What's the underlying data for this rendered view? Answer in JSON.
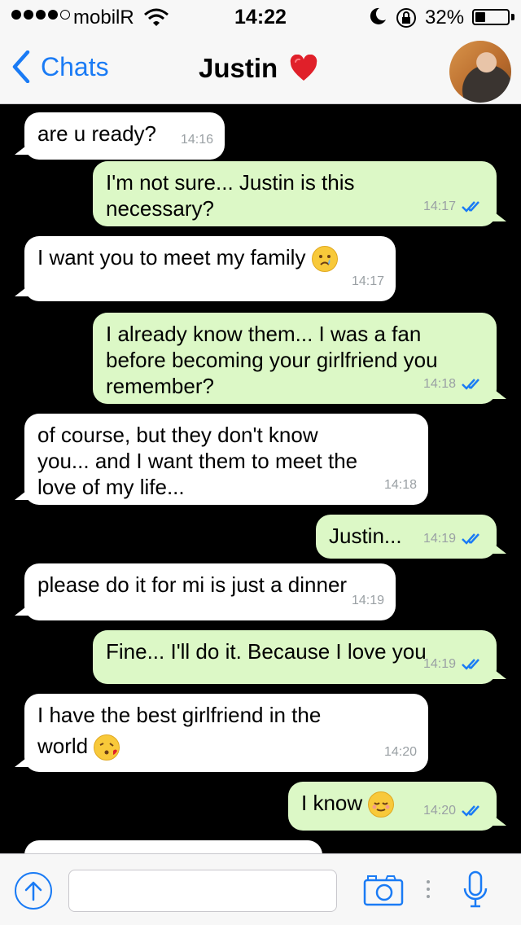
{
  "status_bar": {
    "carrier": "mobilR",
    "time": "14:22",
    "battery_percent": "32%",
    "battery_level": 0.32
  },
  "nav": {
    "back_label": "Chats",
    "contact_name": "Justin",
    "accent_color": "#1a7bf5"
  },
  "messages": [
    {
      "dir": "in",
      "text": "are u ready?",
      "time": "14:16"
    },
    {
      "dir": "out",
      "text_lines": [
        "I'm not sure... Justin is this",
        "necessary?"
      ],
      "time": "14:17",
      "read": true
    },
    {
      "dir": "in",
      "text": "I want you to meet my family",
      "emoji": "crying-face",
      "time": "14:17"
    },
    {
      "dir": "out",
      "text_lines": [
        "I already know them... I was a fan",
        "before becoming your girlfriend you",
        "remember?"
      ],
      "time": "14:18",
      "read": true
    },
    {
      "dir": "in",
      "text_lines": [
        "of course, but they don't know",
        "you... and I want them to meet the",
        "love of my life..."
      ],
      "time": "14:18"
    },
    {
      "dir": "out",
      "text": "Justin...",
      "time": "14:19",
      "read": true
    },
    {
      "dir": "in",
      "text": "please do it for mi is just a dinner",
      "time": "14:19"
    },
    {
      "dir": "out",
      "text": "Fine... I'll do it. Because I love you",
      "time": "14:19",
      "read": true
    },
    {
      "dir": "in",
      "text_lines": [
        "I have the best girlfriend in the",
        "world"
      ],
      "emoji": "kissing-face",
      "time": "14:20"
    },
    {
      "dir": "out",
      "text": "I know",
      "emoji": "relieved-face",
      "time": "14:20",
      "read": true
    }
  ],
  "colors": {
    "incoming_bubble": "#ffffff",
    "outgoing_bubble": "#dcf8c6",
    "chat_background": "#000000",
    "read_check": "#1a7bf5"
  }
}
